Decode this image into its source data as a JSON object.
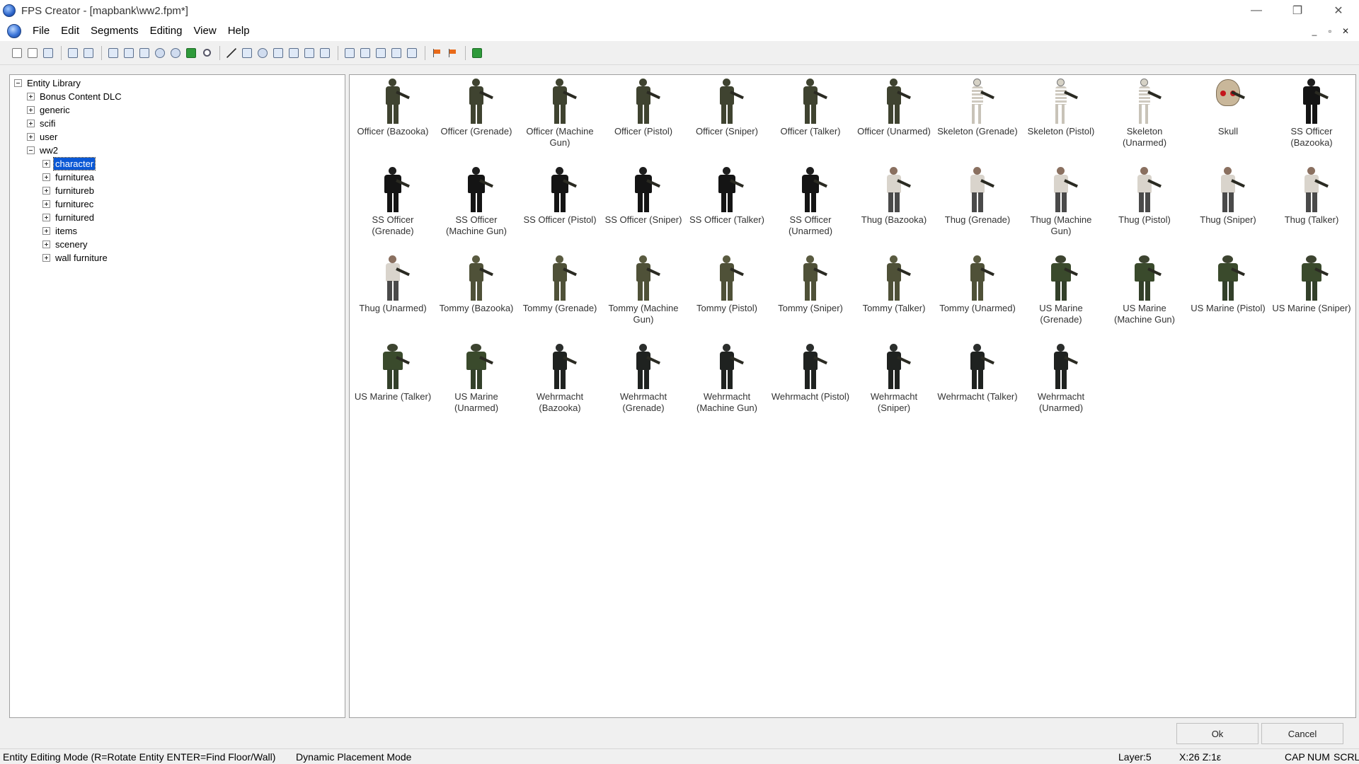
{
  "window": {
    "title": "FPS Creator - [mapbank\\ww2.fpm*]",
    "controls": {
      "minimize": "—",
      "restore": "❐",
      "close": "✕"
    }
  },
  "menu": {
    "items": [
      "File",
      "Edit",
      "Segments",
      "Editing",
      "View",
      "Help"
    ],
    "mdi": {
      "minimize": "_",
      "restore": "▫",
      "close": "✕"
    }
  },
  "toolbar": {
    "icons": [
      "new-icon",
      "open-icon",
      "save-icon",
      "undo-icon",
      "redo-icon",
      "view-icon",
      "layer-icon",
      "segment-icon",
      "entity-icon",
      "marker-icon",
      "picture-icon",
      "zoom-icon",
      "draw-line-icon",
      "draw-box-icon",
      "draw-circle-icon",
      "paint-icon",
      "pick-icon",
      "grab-icon",
      "rotate-icon",
      "copy-icon",
      "paste-icon",
      "erase-icon",
      "wand-icon",
      "select-icon",
      "flag-icon",
      "flag-test-icon",
      "build-game-icon"
    ]
  },
  "tree": {
    "root": "Entity Library",
    "level1": [
      "Bonus Content DLC",
      "generic",
      "scifi",
      "user",
      "ww2"
    ],
    "ww2_children": [
      "character",
      "furniturea",
      "furnitureb",
      "furniturec",
      "furnitured",
      "items",
      "scenery",
      "wall furniture"
    ],
    "selected": "character"
  },
  "entities": [
    {
      "name": "Officer (Bazooka)",
      "kind": "officer"
    },
    {
      "name": "Officer (Grenade)",
      "kind": "officer"
    },
    {
      "name": "Officer (Machine Gun)",
      "kind": "officer"
    },
    {
      "name": "Officer (Pistol)",
      "kind": "officer"
    },
    {
      "name": "Officer (Sniper)",
      "kind": "officer"
    },
    {
      "name": "Officer (Talker)",
      "kind": "officer"
    },
    {
      "name": "Officer (Unarmed)",
      "kind": "officer"
    },
    {
      "name": "Skeleton (Grenade)",
      "kind": "skeleton"
    },
    {
      "name": "Skeleton (Pistol)",
      "kind": "skeleton"
    },
    {
      "name": "Skeleton (Unarmed)",
      "kind": "skeleton"
    },
    {
      "name": "Skull",
      "kind": "skull"
    },
    {
      "name": "SS Officer (Bazooka)",
      "kind": "ss"
    },
    {
      "name": "SS Officer (Grenade)",
      "kind": "ss"
    },
    {
      "name": "SS Officer (Machine Gun)",
      "kind": "ss"
    },
    {
      "name": "SS Officer (Pistol)",
      "kind": "ss"
    },
    {
      "name": "SS Officer (Sniper)",
      "kind": "ss"
    },
    {
      "name": "SS Officer (Talker)",
      "kind": "ss"
    },
    {
      "name": "SS Officer (Unarmed)",
      "kind": "ss"
    },
    {
      "name": "Thug (Bazooka)",
      "kind": "thug"
    },
    {
      "name": "Thug (Grenade)",
      "kind": "thug"
    },
    {
      "name": "Thug (Machine Gun)",
      "kind": "thug"
    },
    {
      "name": "Thug (Pistol)",
      "kind": "thug"
    },
    {
      "name": "Thug (Sniper)",
      "kind": "thug"
    },
    {
      "name": "Thug (Talker)",
      "kind": "thug"
    },
    {
      "name": "Thug (Unarmed)",
      "kind": "thug"
    },
    {
      "name": "Tommy (Bazooka)",
      "kind": "tommy"
    },
    {
      "name": "Tommy (Grenade)",
      "kind": "tommy"
    },
    {
      "name": "Tommy (Machine Gun)",
      "kind": "tommy"
    },
    {
      "name": "Tommy (Pistol)",
      "kind": "tommy"
    },
    {
      "name": "Tommy (Sniper)",
      "kind": "tommy"
    },
    {
      "name": "Tommy (Talker)",
      "kind": "tommy"
    },
    {
      "name": "Tommy (Unarmed)",
      "kind": "tommy"
    },
    {
      "name": "US Marine (Grenade)",
      "kind": "marine"
    },
    {
      "name": "US Marine (Machine Gun)",
      "kind": "marine"
    },
    {
      "name": "US Marine (Pistol)",
      "kind": "marine"
    },
    {
      "name": "US Marine (Sniper)",
      "kind": "marine"
    },
    {
      "name": "US Marine (Talker)",
      "kind": "marine"
    },
    {
      "name": "US Marine (Unarmed)",
      "kind": "marine"
    },
    {
      "name": "Wehrmacht (Bazooka)",
      "kind": "wehr"
    },
    {
      "name": "Wehrmacht (Grenade)",
      "kind": "wehr"
    },
    {
      "name": "Wehrmacht (Machine Gun)",
      "kind": "wehr"
    },
    {
      "name": "Wehrmacht (Pistol)",
      "kind": "wehr"
    },
    {
      "name": "Wehrmacht (Sniper)",
      "kind": "wehr"
    },
    {
      "name": "Wehrmacht (Talker)",
      "kind": "wehr"
    },
    {
      "name": "Wehrmacht (Unarmed)",
      "kind": "wehr"
    }
  ],
  "buttons": {
    "ok": "Ok",
    "cancel": "Cancel"
  },
  "status": {
    "mode": "Entity Editing Mode (R=Rotate Entity  ENTER=Find Floor/Wall)",
    "placement": "Dynamic Placement Mode",
    "layer": "Layer:5",
    "coords": "X:26  Z:1ε",
    "cap": "CAP",
    "num": "NUM",
    "scrl": "SCRL"
  },
  "colors": {
    "selection": "#0a58d6",
    "window_bg": "#f0f0f0"
  }
}
